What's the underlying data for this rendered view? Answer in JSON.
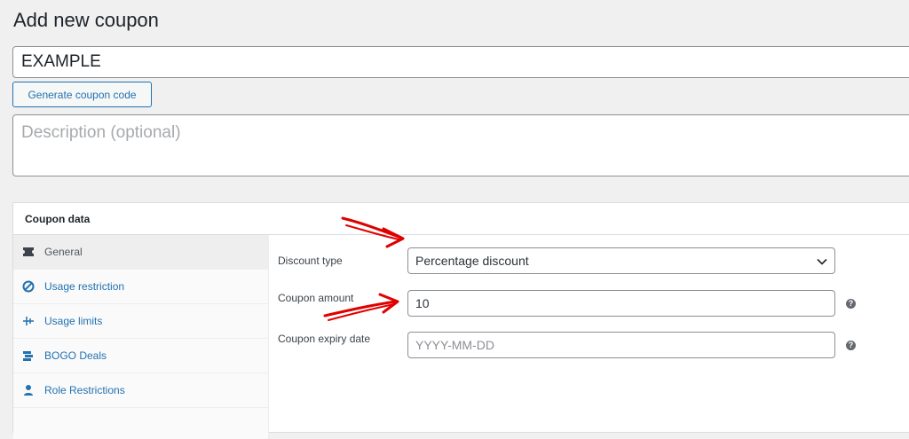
{
  "page": {
    "title": "Add new coupon"
  },
  "coupon": {
    "code_value": "EXAMPLE",
    "generate_label": "Generate coupon code",
    "description_placeholder": "Description (optional)"
  },
  "panel": {
    "title": "Coupon data",
    "tabs": [
      {
        "label": "General",
        "icon": "ticket-icon",
        "active": true
      },
      {
        "label": "Usage restriction",
        "icon": "no-entry-icon"
      },
      {
        "label": "Usage limits",
        "icon": "limits-icon"
      },
      {
        "label": "BOGO Deals",
        "icon": "bogo-icon"
      },
      {
        "label": "Role Restrictions",
        "icon": "user-icon"
      }
    ]
  },
  "fields": {
    "discount_type": {
      "label": "Discount type",
      "value": "Percentage discount"
    },
    "amount": {
      "label": "Coupon amount",
      "value": "10"
    },
    "expiry": {
      "label": "Coupon expiry date",
      "placeholder": "YYYY-MM-DD"
    }
  },
  "colors": {
    "link": "#2271b1",
    "annotation": "#e00000"
  }
}
